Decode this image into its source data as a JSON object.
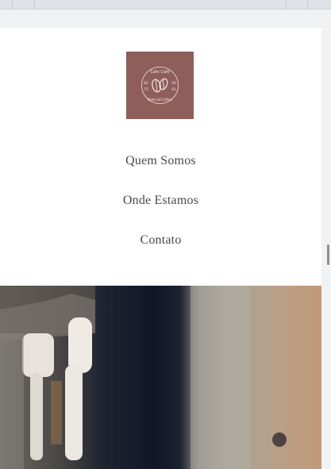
{
  "logo": {
    "top_text": "Cafe Café",
    "bottom_text": "NaturalCoffee",
    "left_top": "82",
    "left_bottom": "75",
    "right_top": "30",
    "right_bottom": "91",
    "bg_color": "#8e5e5b"
  },
  "nav": {
    "items": [
      {
        "label": "Quem Somos"
      },
      {
        "label": "Onde Estamos"
      },
      {
        "label": "Contato"
      }
    ]
  },
  "colors": {
    "page_bg": "#ffffff",
    "nav_text": "#4a4a4a"
  }
}
